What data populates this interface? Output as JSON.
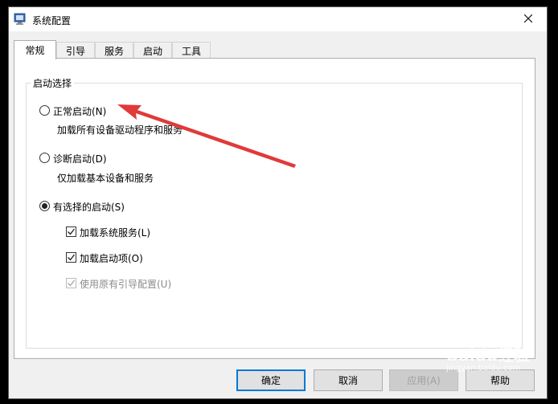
{
  "window": {
    "title": "系统配置"
  },
  "tabs": [
    {
      "label": "常规",
      "active": true
    },
    {
      "label": "引导"
    },
    {
      "label": "服务"
    },
    {
      "label": "启动"
    },
    {
      "label": "工具"
    }
  ],
  "startup_group": {
    "title": "启动选择",
    "normal": {
      "label": "正常启动(N)",
      "desc": "加载所有设备驱动程序和服务",
      "selected": false
    },
    "diagnostic": {
      "label": "诊断启动(D)",
      "desc": "仅加载基本设备和服务",
      "selected": false
    },
    "selective": {
      "label": "有选择的启动(S)",
      "selected": true
    },
    "options": {
      "load_system_services": {
        "label": "加载系统服务(L)",
        "checked": true
      },
      "load_startup_items": {
        "label": "加载启动项(O)",
        "checked": true
      },
      "use_original_boot": {
        "label": "使用原有引导配置(U)",
        "checked": true,
        "disabled": true
      }
    }
  },
  "buttons": {
    "ok": "确定",
    "cancel": "取消",
    "apply": "应用(A)",
    "help": "帮助"
  },
  "watermark": {
    "brand": "Baidu经验",
    "url": "jingyan.baidu.com"
  },
  "annotation_arrow_color": "#e03a3a"
}
